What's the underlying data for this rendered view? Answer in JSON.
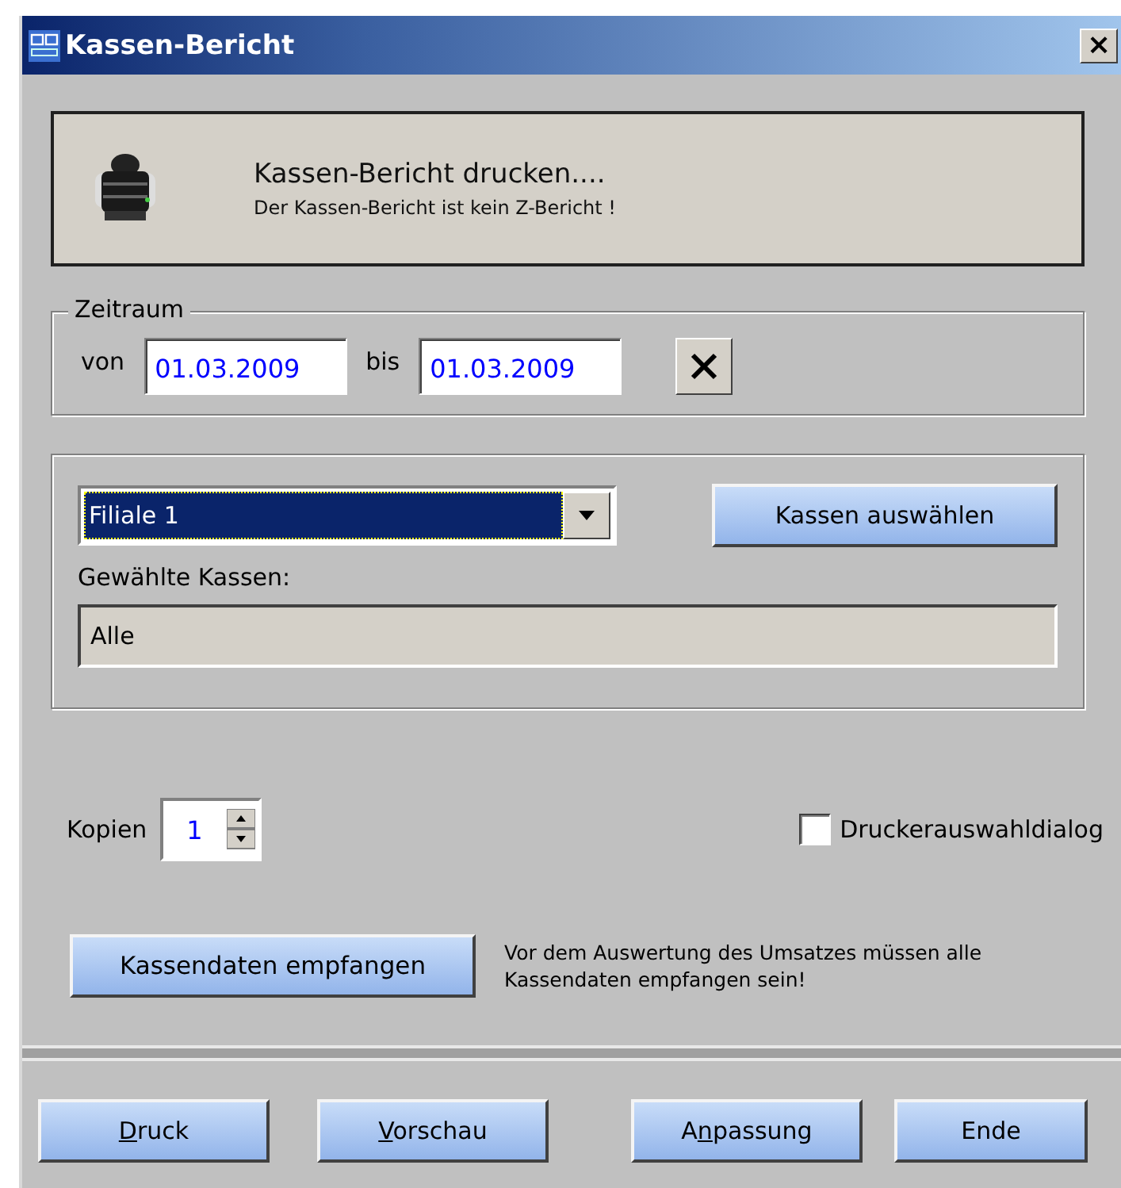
{
  "window": {
    "title": "Kassen-Bericht",
    "close": "×"
  },
  "header": {
    "title": "Kassen-Bericht drucken....",
    "subtitle": "Der Kassen-Bericht ist kein Z-Bericht !"
  },
  "zeitraum": {
    "legend": "Zeitraum",
    "from_label": "von",
    "from": "01.03.2009",
    "to_label": "bis",
    "to": "01.03.2009"
  },
  "kassen": {
    "branch": "Filiale 1",
    "select_button": "Kassen auswählen",
    "chosen_label": "Gewählte Kassen:",
    "chosen": "Alle"
  },
  "kopien": {
    "label": "Kopien",
    "value": "1"
  },
  "printer_dialog": {
    "label": "Druckerauswahldialog",
    "checked": false
  },
  "receive": {
    "button": "Kassendaten empfangen",
    "note": "Vor dem Auswertung des Umsatzes müssen alle Kassendaten empfangen sein!"
  },
  "buttons": [
    {
      "key": "D",
      "after": "ruck"
    },
    {
      "key": "V",
      "after": "orschau"
    },
    {
      "before": "A",
      "key": "n",
      "after": "passung"
    },
    {
      "before": "Ende"
    }
  ]
}
